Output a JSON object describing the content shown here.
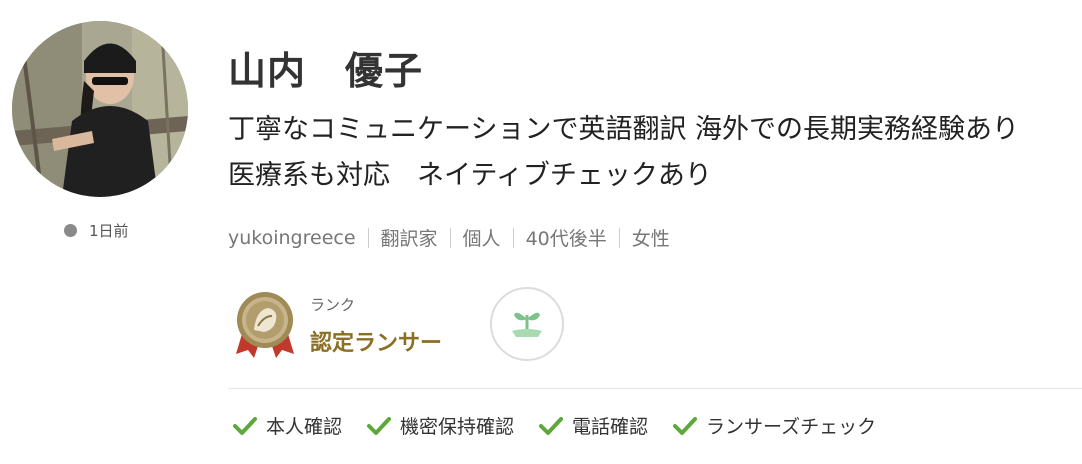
{
  "profile": {
    "name": "山内　優子",
    "catchphrase_line1": "丁寧なコミュニケーションで英語翻訳 海外での長期実務経験あり",
    "catchphrase_line2": "医療系も対応　ネイティブチェックあり",
    "last_active": "1日前",
    "status_color": "#8a8a8a"
  },
  "meta": {
    "username": "yukoingreece",
    "occupation": "翻訳家",
    "type": "個人",
    "age": "40代後半",
    "gender": "女性"
  },
  "rank": {
    "caption": "ランク",
    "name": "認定ランサー",
    "badge_icon": "certified-lancer-badge-icon",
    "sprout_icon": "sprout-hand-icon",
    "accent_color": "#8a6f24"
  },
  "verifications": [
    {
      "label": "本人確認",
      "icon": "check-icon"
    },
    {
      "label": "機密保持確認",
      "icon": "check-icon"
    },
    {
      "label": "電話確認",
      "icon": "check-icon"
    },
    {
      "label": "ランサーズチェック",
      "icon": "check-icon"
    }
  ],
  "colors": {
    "check": "#5ea83b",
    "text": "#333333",
    "muted": "#777777"
  }
}
